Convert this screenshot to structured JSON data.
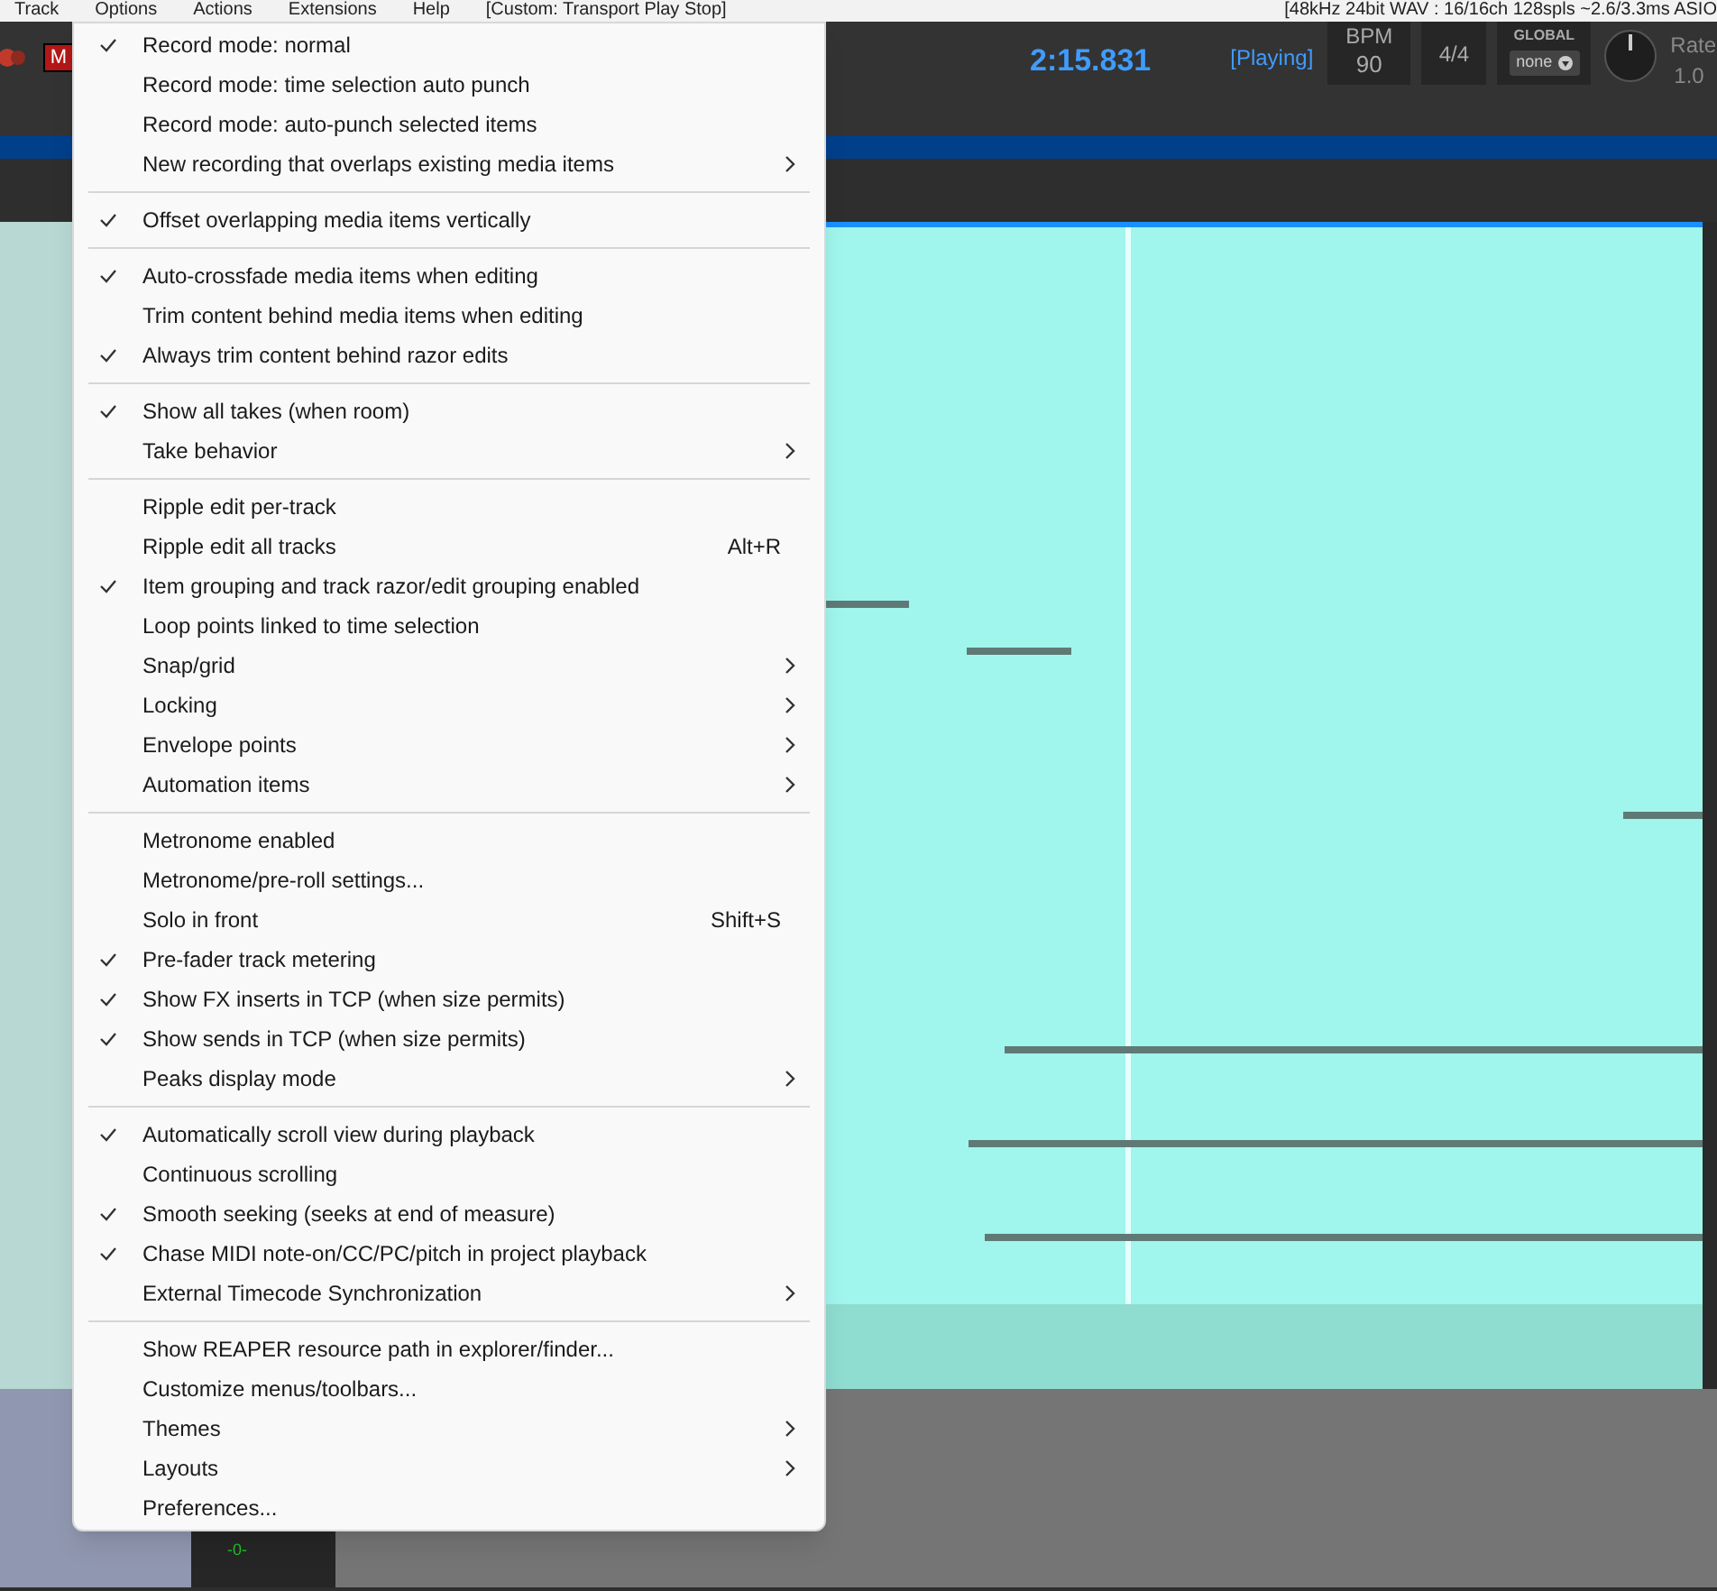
{
  "menubar": {
    "items": [
      "Track",
      "Options",
      "Actions",
      "Extensions",
      "Help"
    ],
    "action_label": "[Custom: Transport Play Stop]",
    "status": "[48kHz 24bit WAV : 16/16ch 128spls ~2.6/3.3ms ASIO"
  },
  "transport": {
    "mute_label": "M",
    "time": "2:15.831",
    "state": "[Playing]",
    "bpm_label": "BPM",
    "bpm": "90",
    "signature": "4/4",
    "global_label": "GLOBAL",
    "global_value": "none",
    "rate_label": "Rate",
    "rate": "1.0"
  },
  "meter_label": "-0-",
  "menu": [
    [
      {
        "label": "Record mode: normal",
        "checked": true
      },
      {
        "label": "Record mode: time selection auto punch",
        "checked": false
      },
      {
        "label": "Record mode: auto-punch selected items",
        "checked": false
      },
      {
        "label": "New recording that overlaps existing media items",
        "checked": false,
        "submenu": true
      }
    ],
    [
      {
        "label": "Offset overlapping media items vertically",
        "checked": true
      }
    ],
    [
      {
        "label": "Auto-crossfade media items when editing",
        "checked": true
      },
      {
        "label": "Trim content behind media items when editing",
        "checked": false
      },
      {
        "label": "Always trim content behind razor edits",
        "checked": true
      }
    ],
    [
      {
        "label": "Show all takes (when room)",
        "checked": true
      },
      {
        "label": "Take behavior",
        "checked": false,
        "submenu": true
      }
    ],
    [
      {
        "label": "Ripple edit per-track",
        "checked": false
      },
      {
        "label": "Ripple edit all tracks",
        "checked": false,
        "shortcut": "Alt+R"
      },
      {
        "label": "Item grouping and track razor/edit grouping enabled",
        "checked": true
      },
      {
        "label": "Loop points linked to time selection",
        "checked": false
      },
      {
        "label": "Snap/grid",
        "checked": false,
        "submenu": true
      },
      {
        "label": "Locking",
        "checked": false,
        "submenu": true
      },
      {
        "label": "Envelope points",
        "checked": false,
        "submenu": true
      },
      {
        "label": "Automation items",
        "checked": false,
        "submenu": true
      }
    ],
    [
      {
        "label": "Metronome enabled",
        "checked": false
      },
      {
        "label": "Metronome/pre-roll settings...",
        "checked": false
      },
      {
        "label": "Solo in front",
        "checked": false,
        "shortcut": "Shift+S"
      },
      {
        "label": "Pre-fader track metering",
        "checked": true
      },
      {
        "label": "Show FX inserts in TCP (when size permits)",
        "checked": true
      },
      {
        "label": "Show sends in TCP (when size permits)",
        "checked": true
      },
      {
        "label": "Peaks display mode",
        "checked": false,
        "submenu": true
      }
    ],
    [
      {
        "label": "Automatically scroll view during playback",
        "checked": true
      },
      {
        "label": "Continuous scrolling",
        "checked": false
      },
      {
        "label": "Smooth seeking (seeks at end of measure)",
        "checked": true
      },
      {
        "label": "Chase MIDI note-on/CC/PC/pitch in project playback",
        "checked": true
      },
      {
        "label": "External Timecode Synchronization",
        "checked": false,
        "submenu": true
      }
    ],
    [
      {
        "label": "Show REAPER resource path in explorer/finder...",
        "checked": false
      },
      {
        "label": "Customize menus/toolbars...",
        "checked": false
      },
      {
        "label": "Themes",
        "checked": false,
        "submenu": true
      },
      {
        "label": "Layouts",
        "checked": false,
        "submenu": true
      },
      {
        "label": "Preferences...",
        "checked": false
      }
    ]
  ]
}
